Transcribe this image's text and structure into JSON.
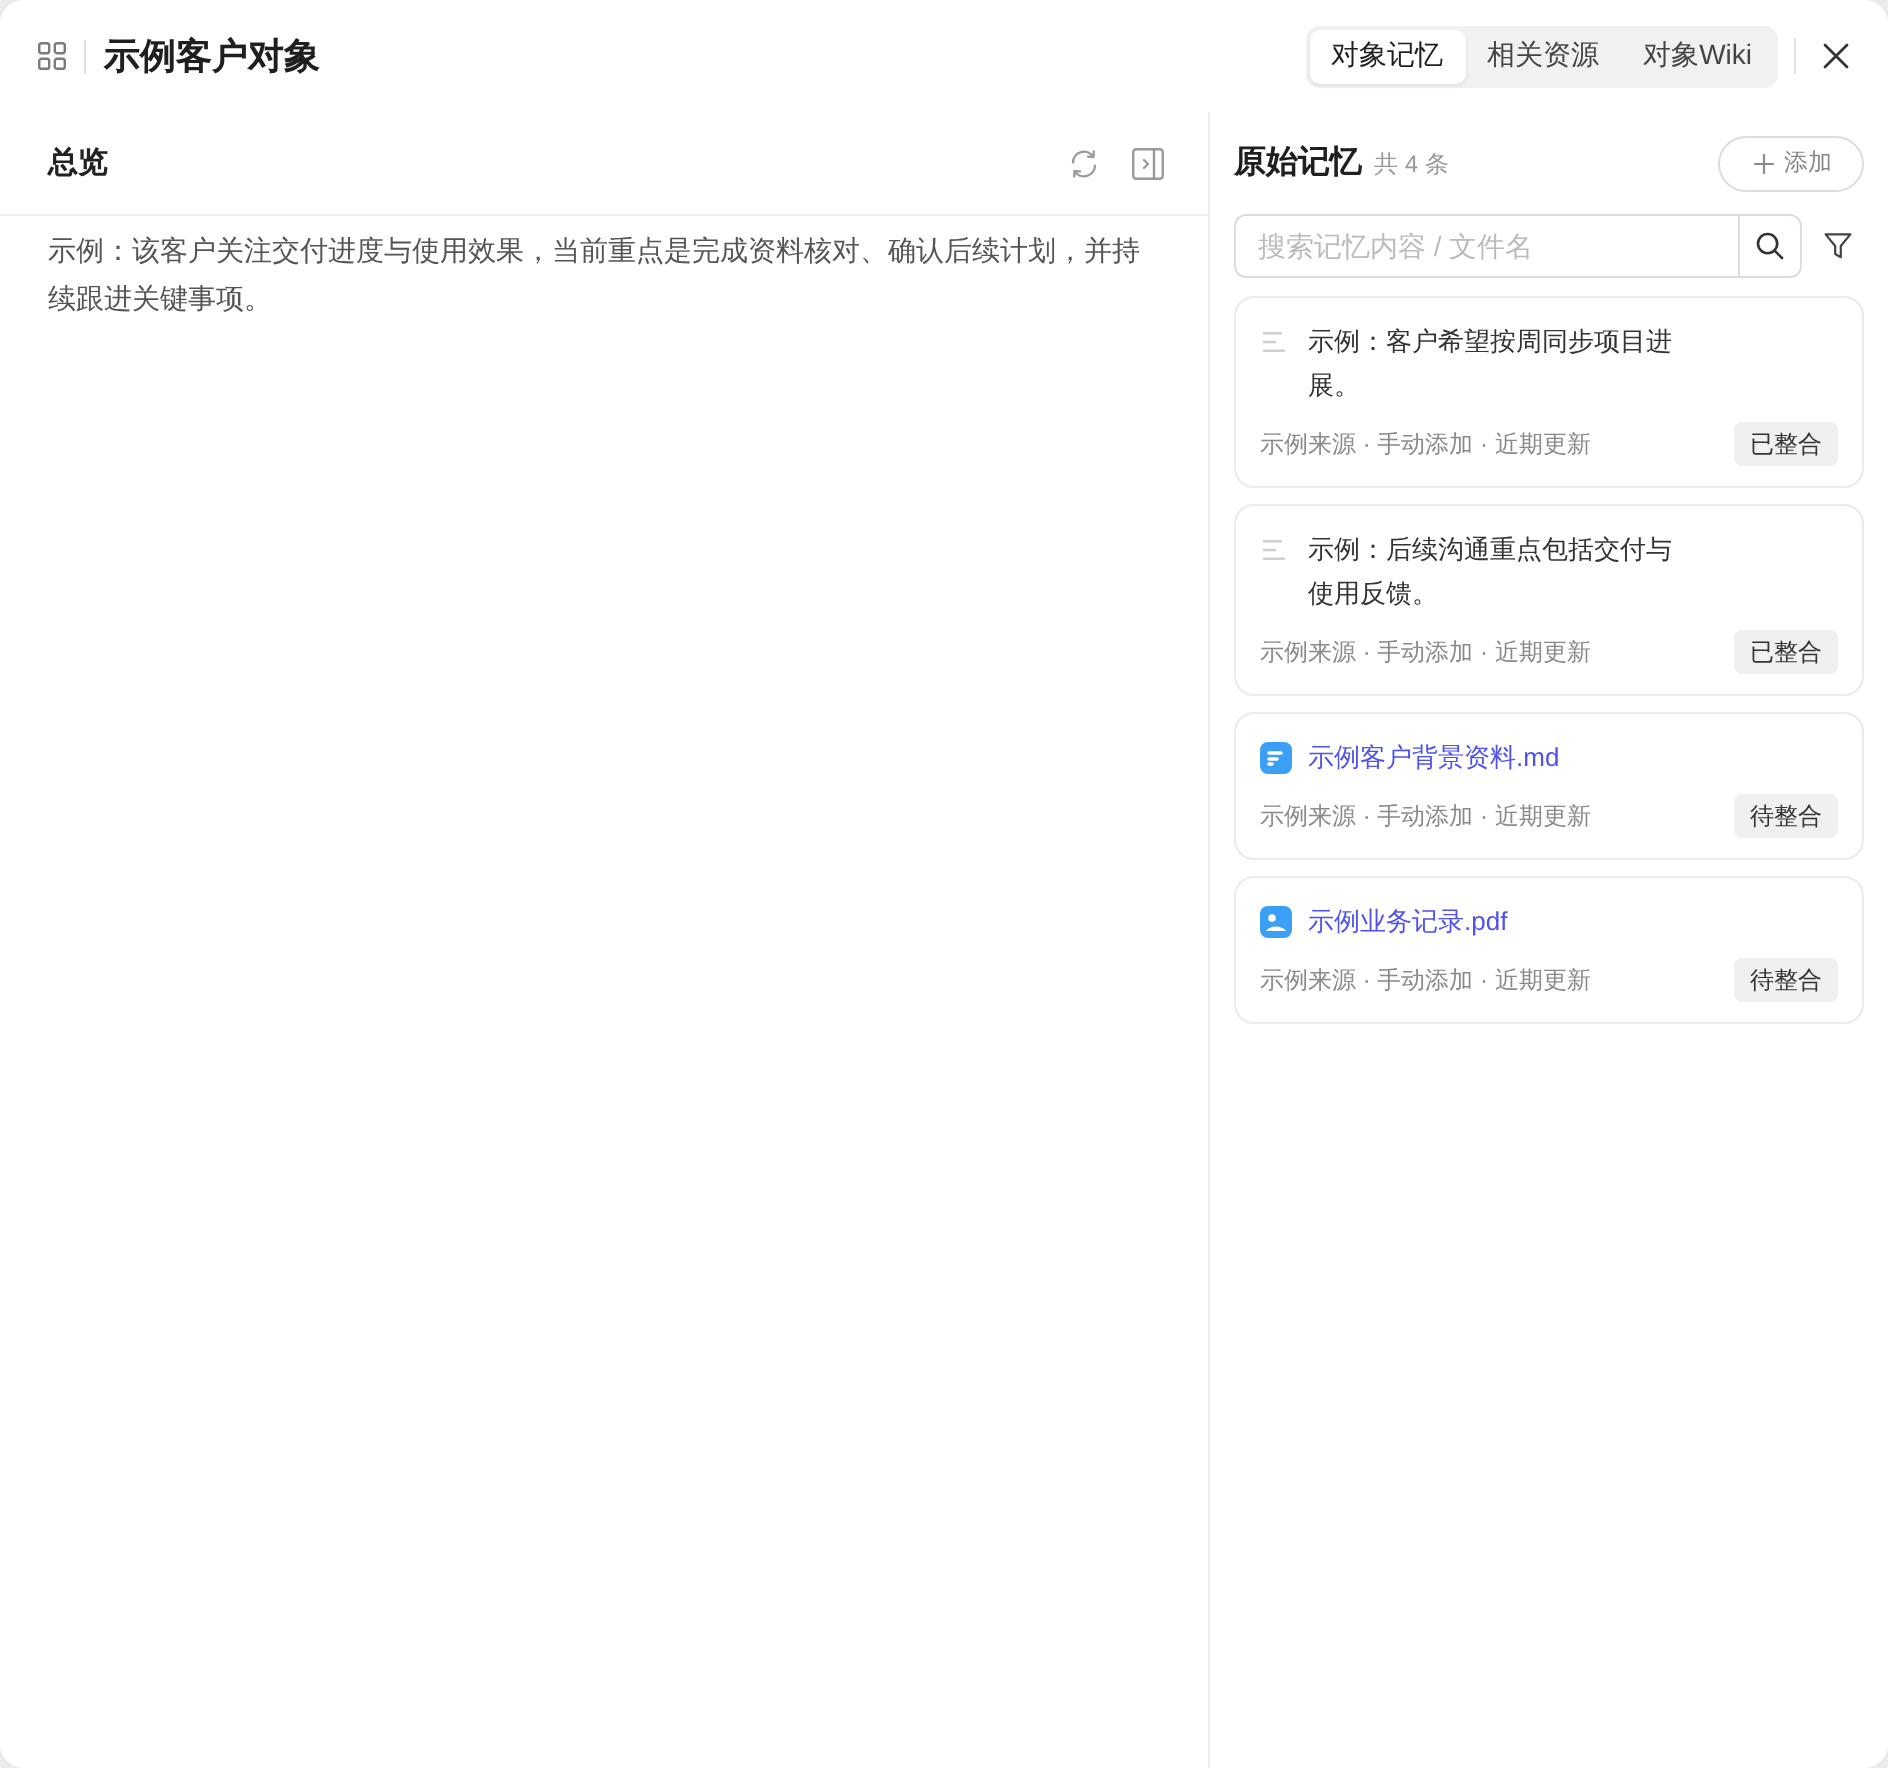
{
  "window": {
    "title": "示例客户对象"
  },
  "tabs": [
    {
      "label": "对象记忆",
      "selected": true
    },
    {
      "label": "相关资源",
      "selected": false
    },
    {
      "label": "对象Wiki",
      "selected": false
    }
  ],
  "overview": {
    "title": "总览",
    "text": "示例：该客户关注交付进度与使用效果，当前重点是完成资料核对、确认后续计划，并持续跟进关键事项。"
  },
  "memory": {
    "title": "原始记忆",
    "count": "共 4 条",
    "add_button": "添加",
    "search": {
      "placeholder": "搜索记忆内容 / 文件名"
    },
    "items": [
      {
        "kind": "note",
        "text": "示例：客户希望按周同步项目进展。",
        "meta": "示例来源 · 手动添加 · 近期更新",
        "status": "已整合"
      },
      {
        "kind": "note",
        "text": "示例：后续沟通重点包括交付与使用反馈。",
        "meta": "示例来源 · 手动添加 · 近期更新",
        "status": "已整合"
      },
      {
        "kind": "doc",
        "text": "示例客户背景资料.md",
        "meta": "示例来源 · 手动添加 · 近期更新",
        "status": "待整合"
      },
      {
        "kind": "image",
        "text": "示例业务记录.pdf",
        "meta": "示例来源 · 手动添加 · 近期更新",
        "status": "待整合"
      }
    ]
  }
}
